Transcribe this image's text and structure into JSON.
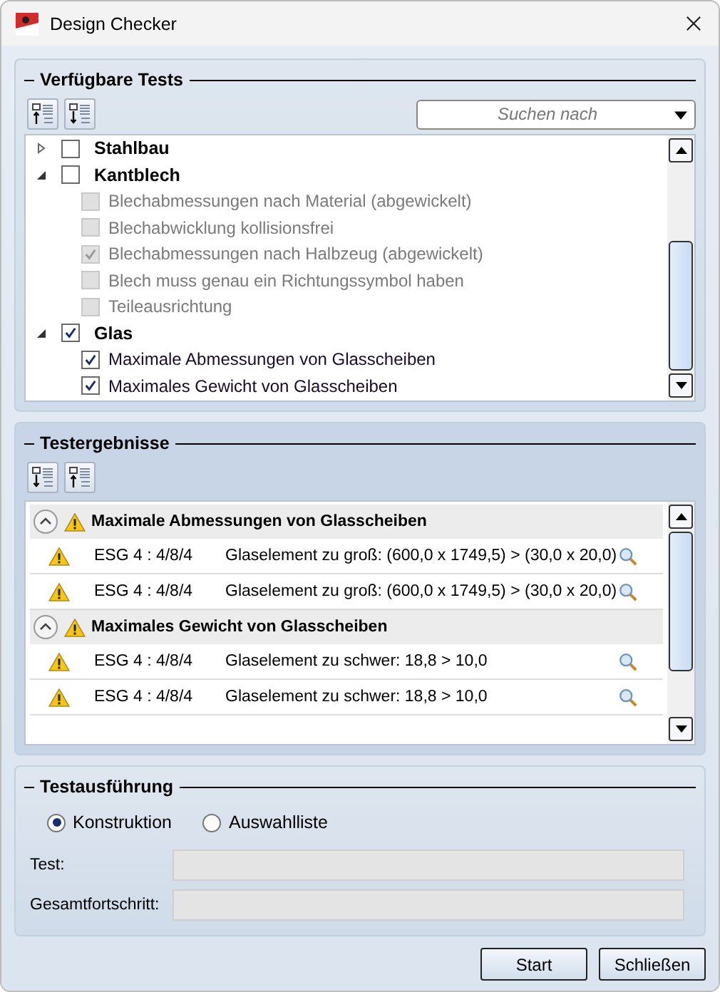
{
  "window": {
    "title": "Design Checker"
  },
  "available_tests": {
    "title": "Verfügbare Tests",
    "search": {
      "placeholder": "Suchen nach"
    },
    "tree": [
      {
        "label": "Stahlbau",
        "expanded": false,
        "checked": false
      },
      {
        "label": "Kantblech",
        "expanded": true,
        "checked": false,
        "children": [
          {
            "label": "Blechabmessungen nach Material (abgewickelt)",
            "checked": false,
            "disabled": true
          },
          {
            "label": "Blechabwicklung kollisionsfrei",
            "checked": false,
            "disabled": true
          },
          {
            "label": "Blechabmessungen nach Halbzeug (abgewickelt)",
            "checked": true,
            "disabled": true
          },
          {
            "label": "Blech muss genau ein Richtungssymbol haben",
            "checked": false,
            "disabled": true
          },
          {
            "label": "Teileausrichtung",
            "checked": false,
            "disabled": true
          }
        ]
      },
      {
        "label": "Glas",
        "expanded": true,
        "checked": true,
        "children": [
          {
            "label": "Maximale Abmessungen von Glasscheiben",
            "checked": true,
            "disabled": false
          },
          {
            "label": "Maximales Gewicht von Glasscheiben",
            "checked": true,
            "disabled": false
          }
        ]
      }
    ]
  },
  "test_results": {
    "title": "Testergebnisse",
    "groups": [
      {
        "title": "Maximale Abmessungen von Glasscheiben",
        "expanded": true,
        "rows": [
          {
            "object": "ESG 4 : 4/8/4",
            "message": "Glaselement zu groß: (600,0 x 1749,5) > (30,0 x 20,0)"
          },
          {
            "object": "ESG 4 : 4/8/4",
            "message": "Glaselement zu groß: (600,0 x 1749,5) > (30,0 x 20,0)"
          }
        ]
      },
      {
        "title": "Maximales Gewicht von Glasscheiben",
        "expanded": true,
        "rows": [
          {
            "object": "ESG 4 : 4/8/4",
            "message": "Glaselement zu schwer: 18,8 > 10,0"
          },
          {
            "object": "ESG 4 : 4/8/4",
            "message": "Glaselement zu schwer: 18,8 > 10,0"
          }
        ]
      }
    ]
  },
  "test_execution": {
    "title": "Testausführung",
    "radios": [
      {
        "label": "Konstruktion",
        "selected": true
      },
      {
        "label": "Auswahlliste",
        "selected": false
      }
    ],
    "progress": [
      {
        "label": "Test:",
        "level": 0
      },
      {
        "label": "Gesamtfortschritt:",
        "level": 0
      }
    ]
  },
  "buttons": [
    "Start",
    "Schließen"
  ]
}
